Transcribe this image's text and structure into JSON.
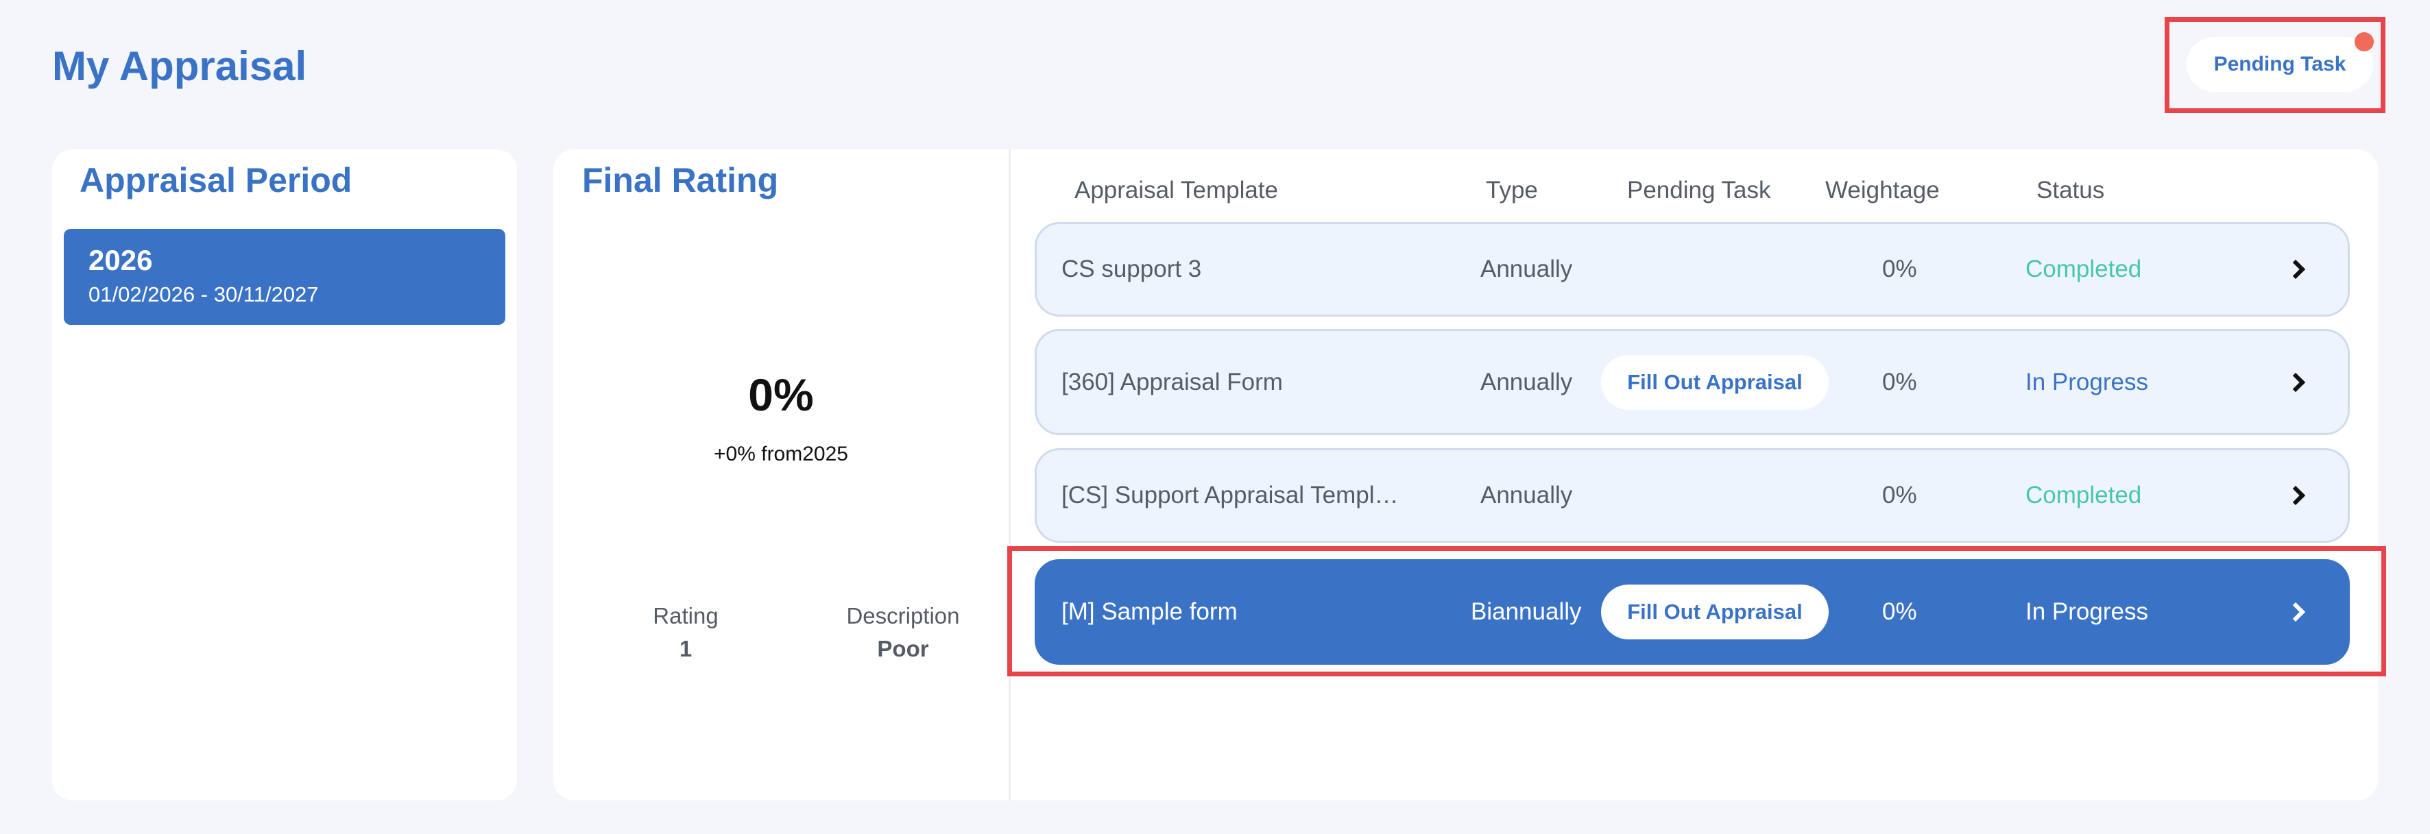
{
  "page": {
    "title": "My Appraisal"
  },
  "header": {
    "pending_task_label": "Pending Task"
  },
  "period": {
    "heading": "Appraisal Period",
    "selected": {
      "year": "2026",
      "range": "01/02/2026 - 30/11/2027"
    }
  },
  "final_rating": {
    "heading": "Final Rating",
    "percent": "0%",
    "change": "+0% from2025",
    "rating_label": "Rating",
    "rating_value": "1",
    "description_label": "Description",
    "description_value": "Poor"
  },
  "table": {
    "columns": {
      "template": "Appraisal Template",
      "type": "Type",
      "pending": "Pending Task",
      "weightage": "Weightage",
      "status": "Status"
    },
    "rows": [
      {
        "template": "CS support 3",
        "type": "Annually",
        "pending": "",
        "weightage": "0%",
        "status": "Completed"
      },
      {
        "template": "[360] Appraisal Form",
        "type": "Annually",
        "pending": "Fill Out Appraisal",
        "weightage": "0%",
        "status": "In Progress"
      },
      {
        "template": "[CS] Support Appraisal Templ…",
        "type": "Annually",
        "pending": "",
        "weightage": "0%",
        "status": "Completed"
      },
      {
        "template": "[M] Sample form",
        "type": "Biannually",
        "pending": "Fill Out Appraisal",
        "weightage": "0%",
        "status": "In Progress"
      }
    ]
  },
  "colors": {
    "accent": "#3a73c5",
    "completed": "#48c7a8",
    "highlight": "#e8454a",
    "notification_dot": "#f26a5a"
  }
}
